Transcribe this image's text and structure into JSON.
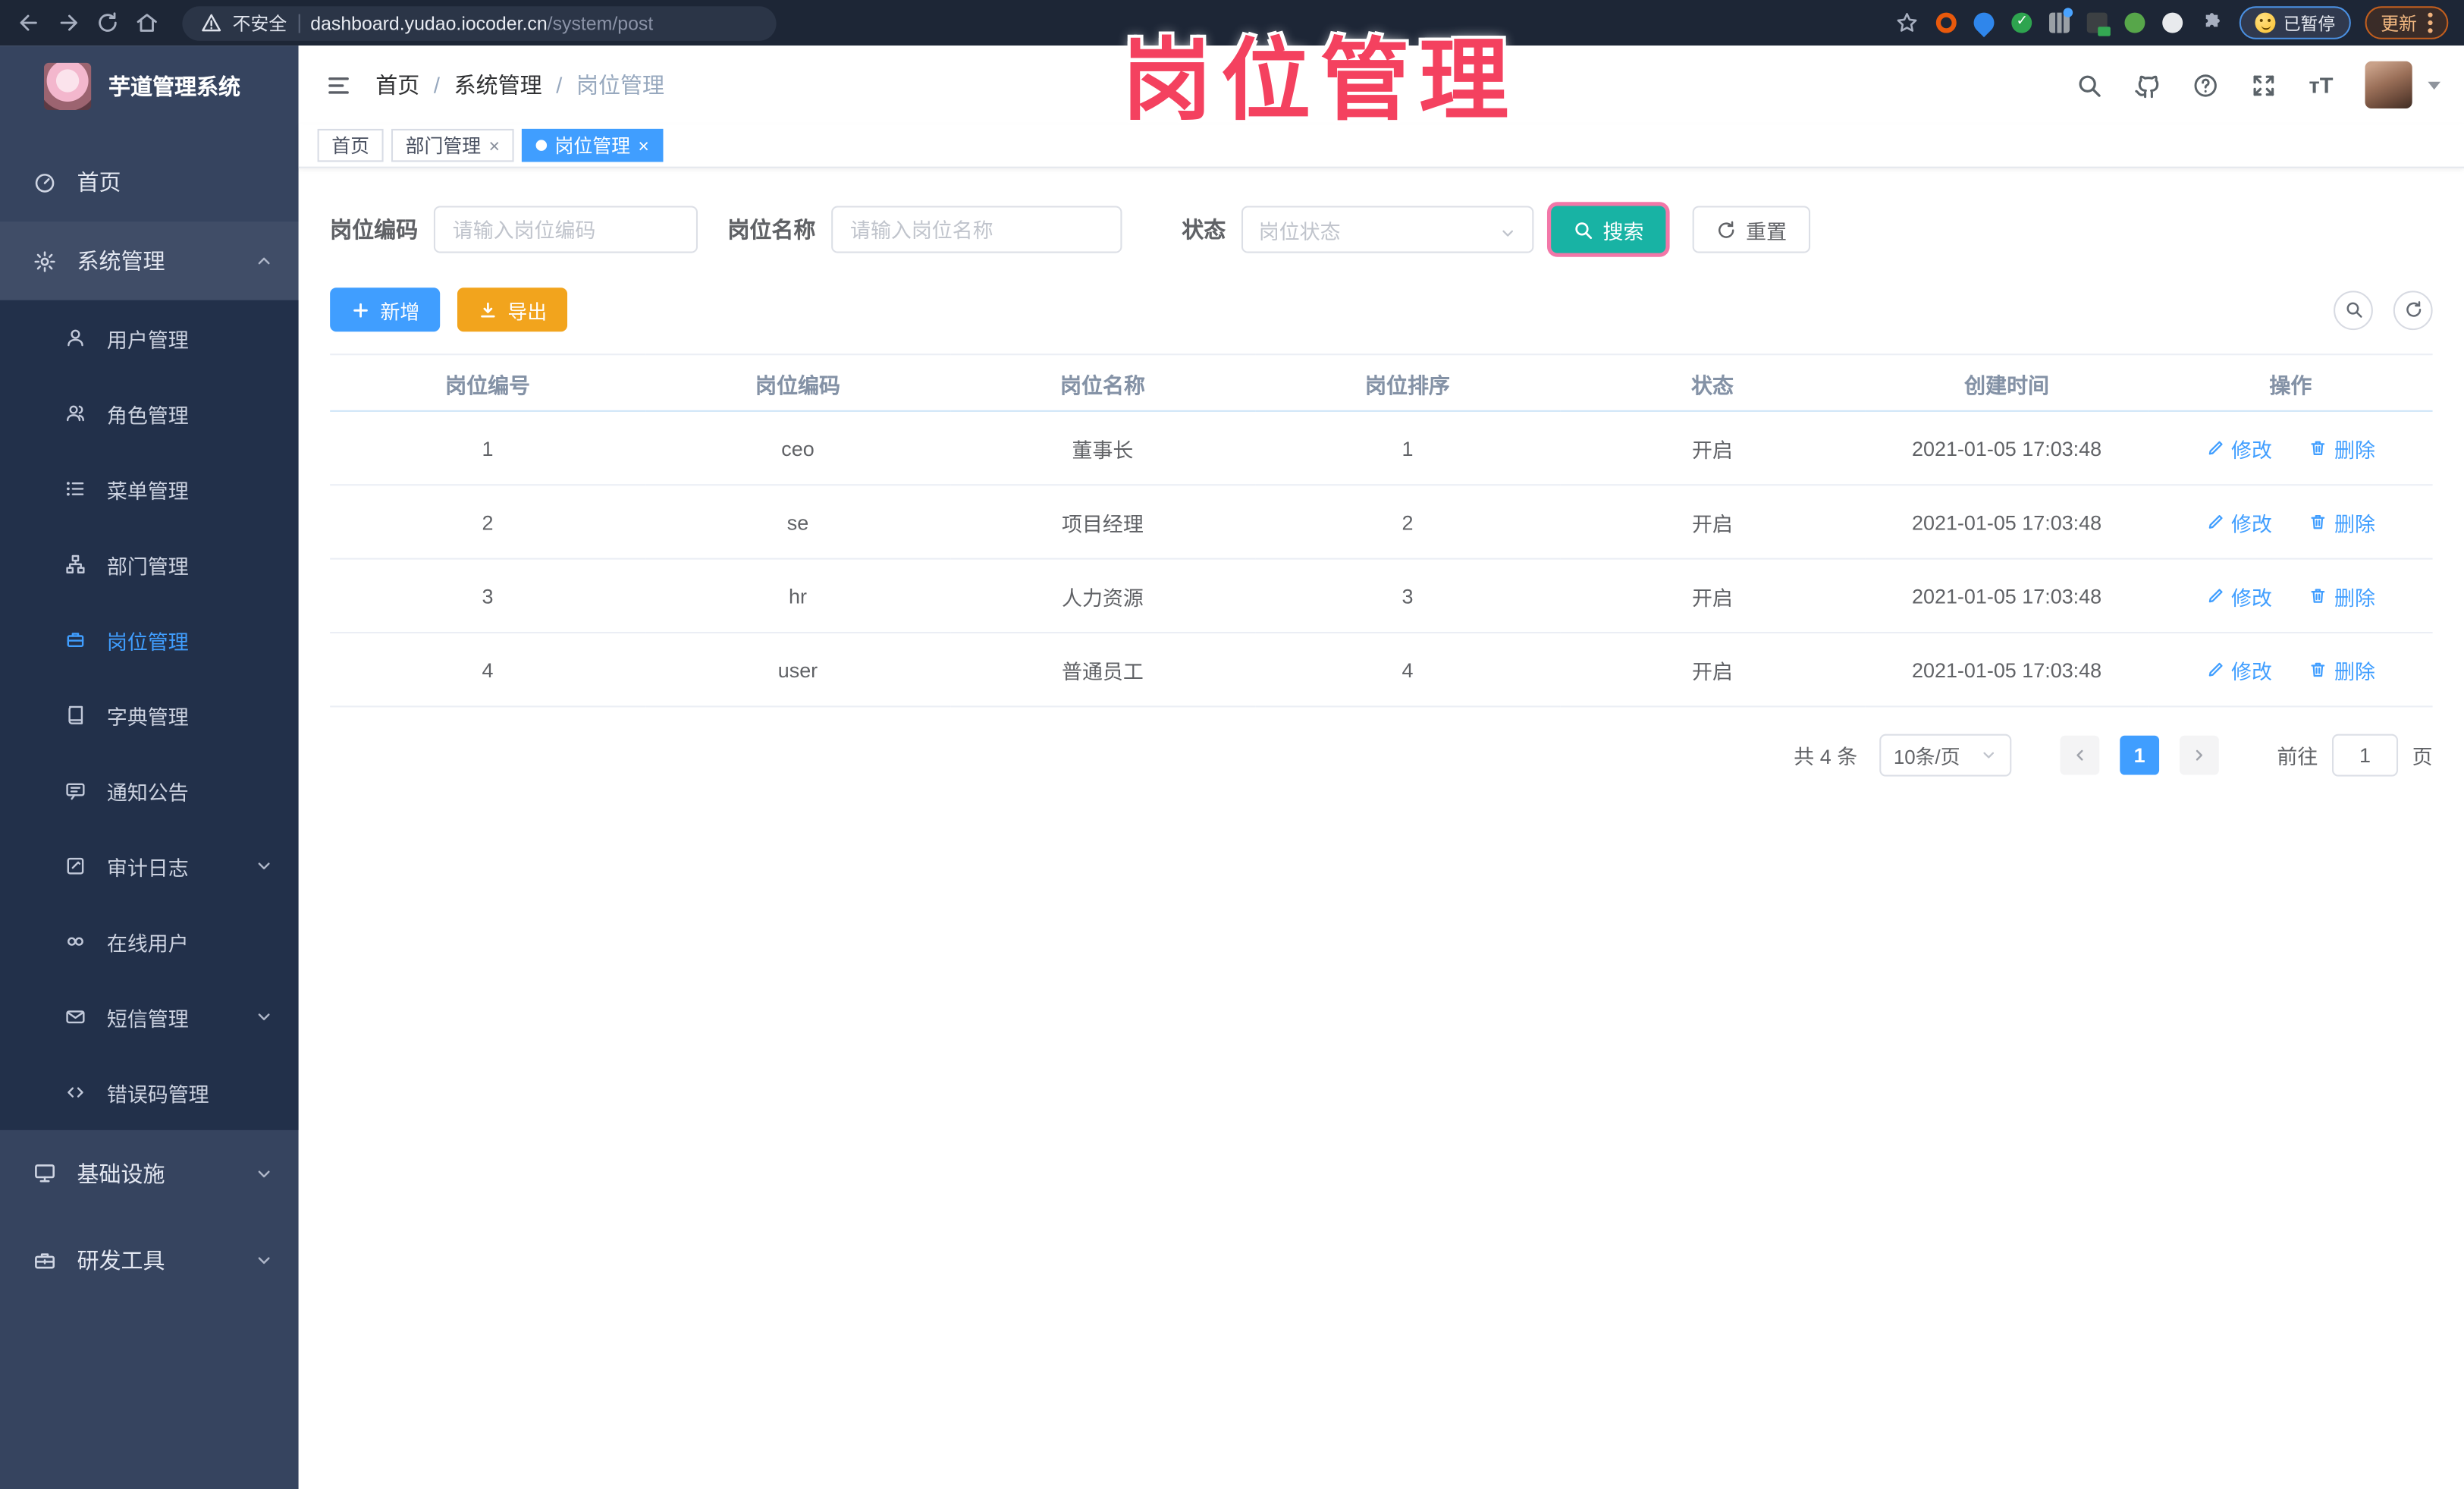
{
  "colors": {
    "accent": "#409eff",
    "search_teal": "#18b3a4",
    "export_orange": "#f2a41d",
    "overlay_pink": "#f4415f",
    "sidebar_bg": "#36445f",
    "submenu_bg": "#22304a"
  },
  "overlay": {
    "title": "岗位管理"
  },
  "browser": {
    "security_label": "不安全",
    "url_domain": "dashboard.yudao.iocoder.cn",
    "url_path": "/system/post",
    "paused_chip": "已暂停",
    "update_button": "更新",
    "extensions": [
      {
        "name": "extension-orange-ring",
        "shape": "ext-ring",
        "color": "#e8590c"
      },
      {
        "name": "extension-blue-pin",
        "shape": "ext-pin",
        "color": "#2f86eb"
      },
      {
        "name": "extension-green-check",
        "shape": "ext-check",
        "color": "#2ea44f"
      },
      {
        "name": "extension-grey-bars",
        "shape": "ext-bars",
        "color": "#9aa0a6"
      },
      {
        "name": "extension-dark-badge",
        "shape": "ext-badge",
        "color": "#3c4043"
      },
      {
        "name": "extension-green-dot",
        "shape": "ext-dot",
        "color": "#57a64a"
      },
      {
        "name": "extension-puzzle",
        "shape": "ext-dot",
        "color": "#e8eaed"
      }
    ]
  },
  "sidebar": {
    "logo_title": "芋道管理系统",
    "top_items": [
      {
        "label": "首页",
        "icon": "dashboard-icon"
      },
      {
        "label": "系统管理",
        "icon": "gear-icon",
        "chevron": "up",
        "highlight": true
      }
    ],
    "submenu": [
      {
        "label": "用户管理",
        "icon": "user-icon"
      },
      {
        "label": "角色管理",
        "icon": "role-icon"
      },
      {
        "label": "菜单管理",
        "icon": "menu-list-icon"
      },
      {
        "label": "部门管理",
        "icon": "dept-tree-icon"
      },
      {
        "label": "岗位管理",
        "icon": "post-icon",
        "active": true
      },
      {
        "label": "字典管理",
        "icon": "dict-icon"
      },
      {
        "label": "通知公告",
        "icon": "notice-icon"
      },
      {
        "label": "审计日志",
        "icon": "audit-icon",
        "chevron": "down"
      },
      {
        "label": "在线用户",
        "icon": "online-icon"
      },
      {
        "label": "短信管理",
        "icon": "sms-icon",
        "chevron": "down"
      },
      {
        "label": "错误码管理",
        "icon": "errcode-icon"
      }
    ],
    "bottom_items": [
      {
        "label": "基础设施",
        "icon": "infra-icon",
        "chevron": "down"
      },
      {
        "label": "研发工具",
        "icon": "tools-icon",
        "chevron": "down"
      }
    ]
  },
  "breadcrumb": {
    "items": [
      "首页",
      "系统管理",
      "岗位管理"
    ],
    "separator": "/"
  },
  "tags": [
    {
      "label": "首页"
    },
    {
      "label": "部门管理",
      "closable": true
    },
    {
      "label": "岗位管理",
      "closable": true,
      "active": true
    }
  ],
  "filters": {
    "code_label": "岗位编码",
    "code_placeholder": "请输入岗位编码",
    "name_label": "岗位名称",
    "name_placeholder": "请输入岗位名称",
    "status_label": "状态",
    "status_placeholder": "岗位状态",
    "search_label": "搜索",
    "reset_label": "重置"
  },
  "toolbar": {
    "add_label": "新增",
    "export_label": "导出"
  },
  "table": {
    "columns": [
      "岗位编号",
      "岗位编码",
      "岗位名称",
      "岗位排序",
      "状态",
      "创建时间",
      "操作"
    ],
    "rows": [
      {
        "id": "1",
        "code": "ceo",
        "name": "董事长",
        "sort": "1",
        "status": "开启",
        "created": "2021-01-05 17:03:48"
      },
      {
        "id": "2",
        "code": "se",
        "name": "项目经理",
        "sort": "2",
        "status": "开启",
        "created": "2021-01-05 17:03:48"
      },
      {
        "id": "3",
        "code": "hr",
        "name": "人力资源",
        "sort": "3",
        "status": "开启",
        "created": "2021-01-05 17:03:48"
      },
      {
        "id": "4",
        "code": "user",
        "name": "普通员工",
        "sort": "4",
        "status": "开启",
        "created": "2021-01-05 17:03:48"
      }
    ],
    "edit_label": "修改",
    "delete_label": "删除"
  },
  "pagination": {
    "total": "共 4 条",
    "page_size": "10条/页",
    "current_page": "1",
    "goto_label": "前往",
    "goto_value": "1",
    "unit_label": "页"
  }
}
